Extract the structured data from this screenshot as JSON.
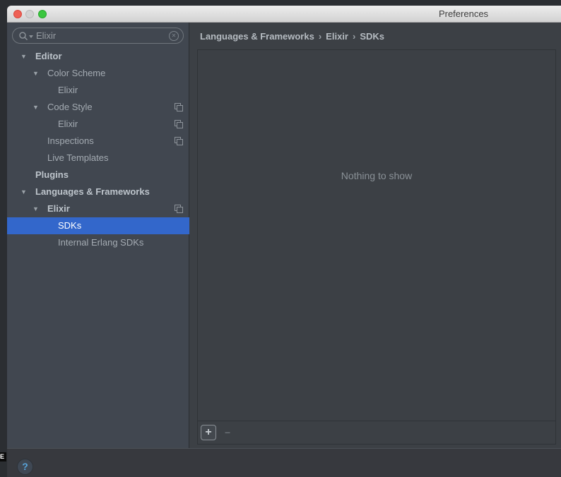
{
  "window": {
    "title": "Preferences"
  },
  "colors": {
    "titlebar_close": "#ee6156",
    "titlebar_minimize": "#d2d2d2",
    "titlebar_zoom": "#3bc63f",
    "selection_blue": "#3367cb",
    "help_accent": "#58a5dc",
    "sidebar_bg": "#414750",
    "content_bg": "#3c4045"
  },
  "search": {
    "value": "Elixir"
  },
  "sidebar": {
    "items": [
      {
        "label": "Editor",
        "level": 0,
        "arrow": true,
        "bold": true
      },
      {
        "label": "Color Scheme",
        "level": 1,
        "arrow": true
      },
      {
        "label": "Elixir",
        "level": 2
      },
      {
        "label": "Code Style",
        "level": 1,
        "arrow": true,
        "copy": true
      },
      {
        "label": "Elixir",
        "level": 2,
        "copy": true
      },
      {
        "label": "Inspections",
        "level": 1,
        "copy": true
      },
      {
        "label": "Live Templates",
        "level": 1
      },
      {
        "label": "Plugins",
        "level": 0,
        "bold": true
      },
      {
        "label": "Languages & Frameworks",
        "level": 0,
        "arrow": true,
        "bold": true
      },
      {
        "label": "Elixir",
        "level": 1,
        "arrow": true,
        "bold": true,
        "copy": true
      },
      {
        "label": "SDKs",
        "level": 2,
        "selected": true
      },
      {
        "label": "Internal Erlang SDKs",
        "level": 2
      }
    ]
  },
  "breadcrumb": {
    "parts": [
      "Languages & Frameworks",
      "Elixir",
      "SDKs"
    ],
    "separator": "›"
  },
  "main": {
    "empty_text": "Nothing to show",
    "toolbar": {
      "add_label": "+",
      "remove_label": "–"
    }
  },
  "footer": {
    "help_label": "?"
  },
  "edge_artifact": {
    "label": "E"
  }
}
